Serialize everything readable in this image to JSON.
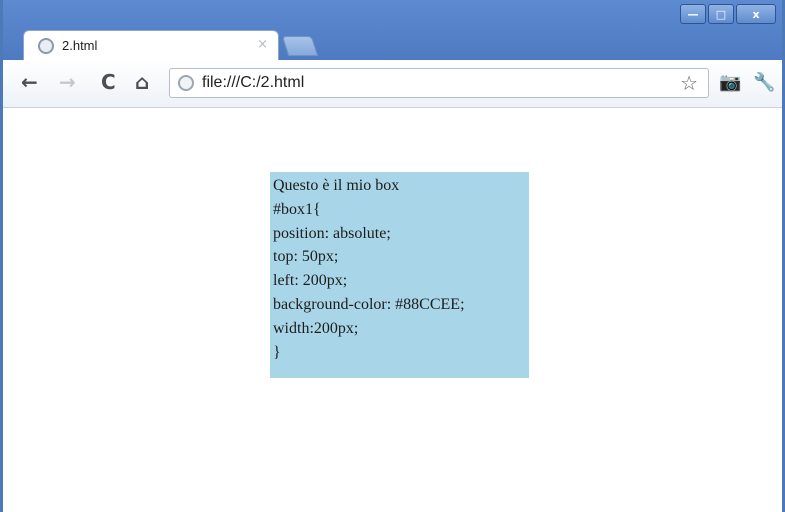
{
  "tab": {
    "title": "2.html",
    "close_glyph": "×",
    "favicon": "globe-icon"
  },
  "window_controls": {
    "minimize": "—",
    "maximize": "□",
    "close": "x"
  },
  "nav": {
    "back": "←",
    "forward": "→",
    "reload": "C",
    "home": "⌂"
  },
  "omnibox": {
    "url": "file:///C:/2.html",
    "star_glyph": "☆"
  },
  "extensions": {
    "camera_glyph": "📷",
    "wrench_glyph": "🔧"
  },
  "page": {
    "box_color": "#A8D6E8",
    "box_lines": [
      "Questo è il mio box",
      "#box1{",
      "position: absolute;",
      "top: 50px;",
      "left: 200px;",
      "background-color: #88CCEE;",
      "width:200px;",
      "}"
    ]
  }
}
